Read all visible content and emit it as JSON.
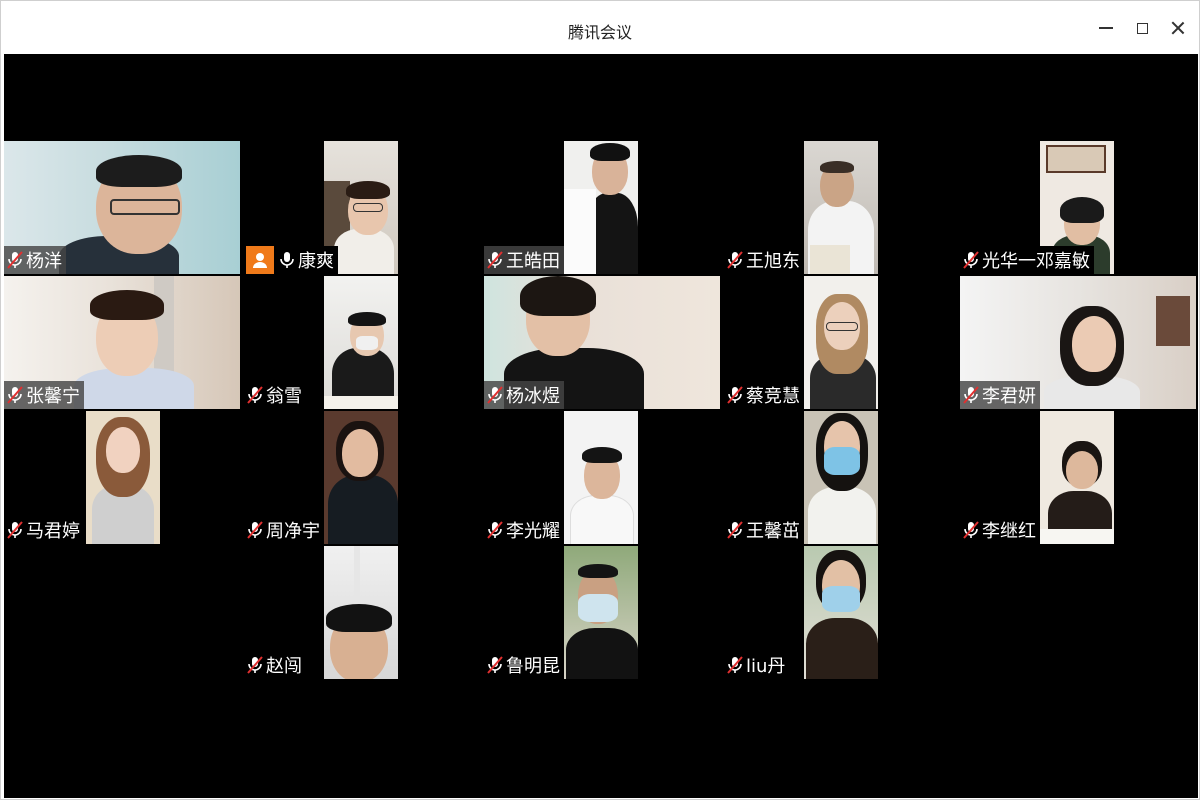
{
  "window": {
    "title": "腾讯会议"
  },
  "participants": [
    {
      "name": "杨洋",
      "mic": "muted"
    },
    {
      "name": "康爽",
      "mic": "on"
    },
    {
      "name": "王皓田",
      "mic": "muted"
    },
    {
      "name": "王旭东",
      "mic": "muted"
    },
    {
      "name": "光华一邓嘉敏",
      "mic": "muted"
    },
    {
      "name": "张馨宁",
      "mic": "muted"
    },
    {
      "name": "翁雪",
      "mic": "muted"
    },
    {
      "name": "杨冰煜",
      "mic": "muted"
    },
    {
      "name": "蔡竞慧",
      "mic": "muted"
    },
    {
      "name": "李君妍",
      "mic": "muted"
    },
    {
      "name": "马君婷",
      "mic": "muted"
    },
    {
      "name": "周净宇",
      "mic": "muted"
    },
    {
      "name": "李光耀",
      "mic": "muted"
    },
    {
      "name": "王馨茁",
      "mic": "muted"
    },
    {
      "name": "李继红",
      "mic": "muted"
    },
    {
      "name": "赵闯",
      "mic": "muted"
    },
    {
      "name": "鲁明昆",
      "mic": "muted"
    },
    {
      "name": "liu丹",
      "mic": "muted"
    }
  ],
  "icons": {
    "muted_mic": "mic-muted-icon",
    "active_mic": "mic-icon",
    "presenter": "user-avatar-icon"
  },
  "colors": {
    "stage_background": "#000000",
    "presenter_badge": "#f07a1a",
    "muted_slash": "#e03030"
  }
}
